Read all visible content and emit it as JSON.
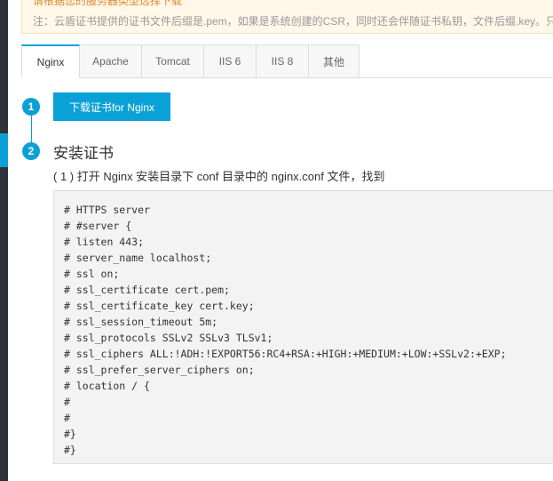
{
  "colors": {
    "accent": "#0aa1d6",
    "notice_bg": "#fff7e8",
    "notice_warn": "#e08a2e",
    "code_bg": "#f3f3f3",
    "sidebar_bg": "#2f3238"
  },
  "notice": {
    "top_text": "请根据您的服务器类型选择下载",
    "text": "注：云盾证书提供的证书文件后缀是.pem，如果是系统创建的CSR，同时还会伴随证书私钥，文件后缀.key。只"
  },
  "tabs": [
    {
      "label": "Nginx",
      "active": true
    },
    {
      "label": "Apache",
      "active": false
    },
    {
      "label": "Tomcat",
      "active": false
    },
    {
      "label": "IIS 6",
      "active": false
    },
    {
      "label": "IIS 8",
      "active": false
    },
    {
      "label": "其他",
      "active": false
    }
  ],
  "steps": {
    "step1": {
      "number": "1",
      "button_label": "下载证书for Nginx"
    },
    "step2": {
      "number": "2",
      "title": "安装证书",
      "description": "( 1 ) 打开 Nginx 安装目录下 conf 目录中的 nginx.conf 文件，找到"
    }
  },
  "code": {
    "lines": [
      "# HTTPS server",
      "# #server {",
      "# listen 443;",
      "# server_name localhost;",
      "# ssl on;",
      "# ssl_certificate cert.pem;",
      "# ssl_certificate_key cert.key;",
      "# ssl_session_timeout 5m;",
      "# ssl_protocols SSLv2 SSLv3 TLSv1;",
      "# ssl_ciphers ALL:!ADH:!EXPORT56:RC4+RSA:+HIGH:+MEDIUM:+LOW:+SSLv2:+EXP;",
      "# ssl_prefer_server_ciphers on;",
      "# location / {",
      "#",
      "#",
      "#}",
      "#}"
    ]
  }
}
